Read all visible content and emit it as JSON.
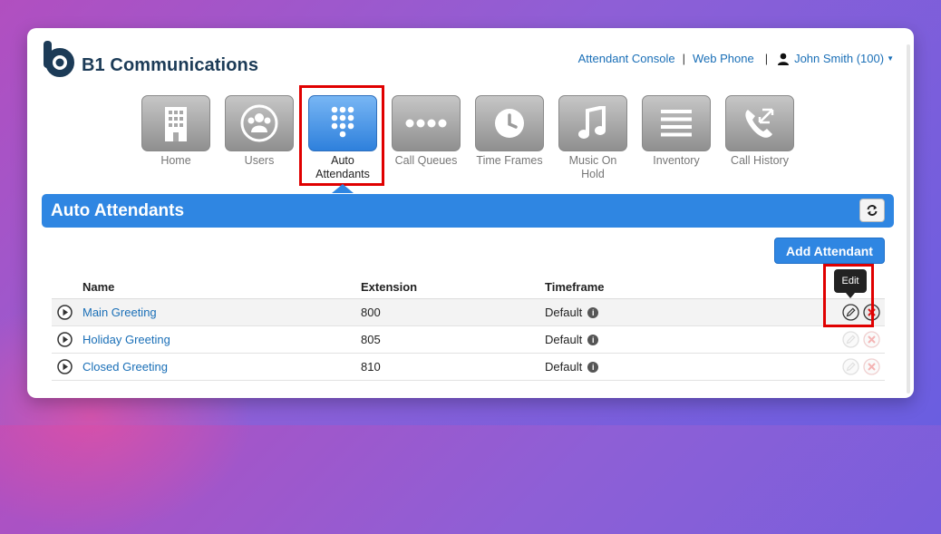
{
  "header": {
    "brand": "B1 Communications",
    "links": [
      "Attendant Console",
      "Web Phone"
    ],
    "user": "John Smith (100)"
  },
  "tiles": [
    {
      "label": "Home",
      "icon": "building-icon"
    },
    {
      "label": "Users",
      "icon": "users-icon"
    },
    {
      "label": "Auto Attendants",
      "icon": "keypad-icon",
      "active": true
    },
    {
      "label": "Call Queues",
      "icon": "dots-icon"
    },
    {
      "label": "Time Frames",
      "icon": "clock-icon"
    },
    {
      "label": "Music On Hold",
      "icon": "music-note-icon"
    },
    {
      "label": "Inventory",
      "icon": "list-icon"
    },
    {
      "label": "Call History",
      "icon": "phone-arrows-icon"
    }
  ],
  "section": {
    "title": "Auto Attendants",
    "add_button": "Add Attendant"
  },
  "table": {
    "columns": [
      "Name",
      "Extension",
      "Timeframe"
    ],
    "rows": [
      {
        "name": "Main Greeting",
        "extension": "800",
        "timeframe": "Default"
      },
      {
        "name": "Holiday Greeting",
        "extension": "805",
        "timeframe": "Default"
      },
      {
        "name": "Closed Greeting",
        "extension": "810",
        "timeframe": "Default"
      }
    ]
  },
  "tooltip": "Edit",
  "colors": {
    "accent": "#2f86e2",
    "highlight": "#e00000",
    "link": "#1a6fb7"
  }
}
